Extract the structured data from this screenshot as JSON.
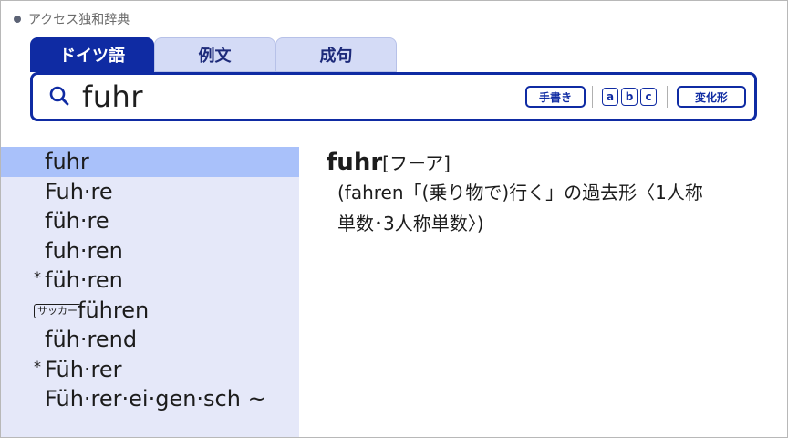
{
  "app": {
    "title": "アクセス独和辞典"
  },
  "tabs": [
    {
      "label": "ドイツ語"
    },
    {
      "label": "例文"
    },
    {
      "label": "成句"
    }
  ],
  "search": {
    "query": "fuhr",
    "buttons": {
      "handwriting": "手書き",
      "conjugation": "変化形",
      "abc": [
        "a",
        "b",
        "c"
      ]
    }
  },
  "results": [
    {
      "word": "fuhr",
      "prefix": ""
    },
    {
      "word": "Fuh·re",
      "prefix": ""
    },
    {
      "word": "füh·re",
      "prefix": ""
    },
    {
      "word": "fuh·ren",
      "prefix": ""
    },
    {
      "word": "füh·ren",
      "prefix": "*"
    },
    {
      "word": "führen",
      "prefix": "サッカー"
    },
    {
      "word": "füh·rend",
      "prefix": ""
    },
    {
      "word": "Füh·rer",
      "prefix": "*"
    },
    {
      "word": "Füh·rer·ei·gen·sch ~",
      "prefix": ""
    }
  ],
  "entry": {
    "headword": "fuhr",
    "pronunciation": "[フーア]",
    "line1": "(fahren「(乗り物で)行く」の過去形〈1人称",
    "line2": "単数･3人称単数〉)"
  },
  "colors": {
    "accent": "#0f2ba3",
    "sidebar_bg": "#e5e8f9",
    "selected_bg": "#a9c1fa"
  }
}
